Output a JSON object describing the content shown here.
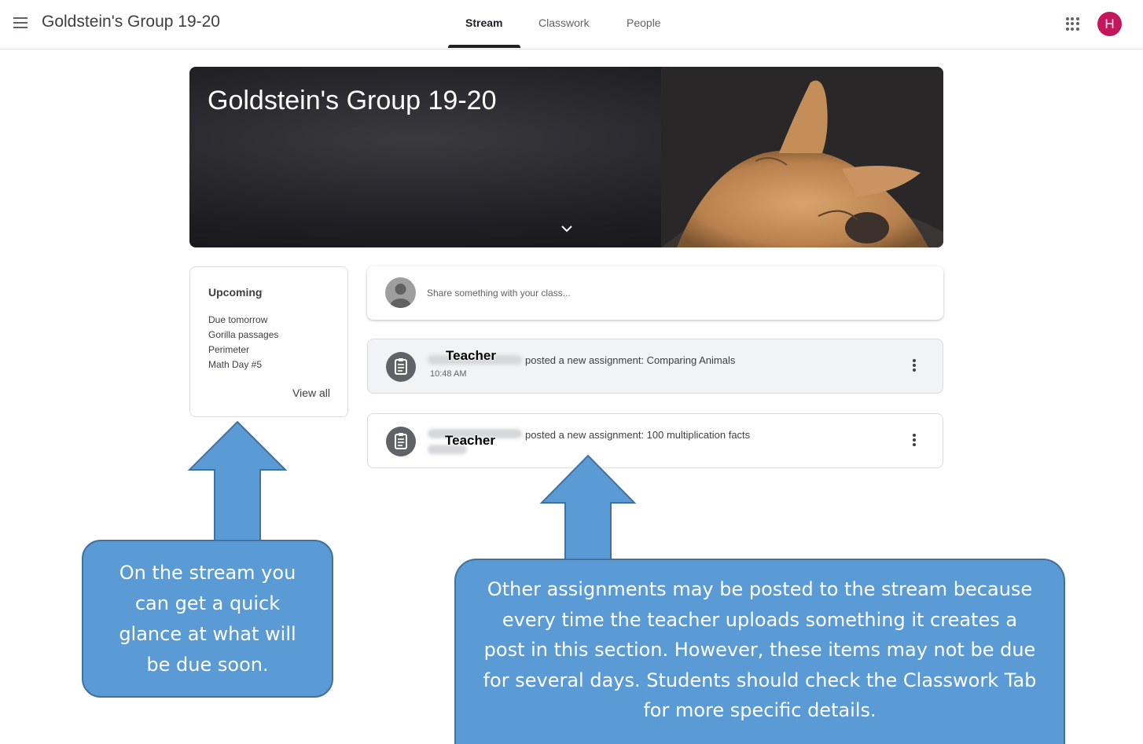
{
  "topbar": {
    "menu_icon": "hamburger-menu-icon",
    "class_title": "Goldstein's Group 19-20",
    "tabs": [
      {
        "label": "Stream",
        "active": true
      },
      {
        "label": "Classwork",
        "active": false
      },
      {
        "label": "People",
        "active": false
      }
    ],
    "apps_icon": "google-apps-grid-icon",
    "avatar_initial": "H",
    "avatar_color": "#c2185b"
  },
  "banner": {
    "title": "Goldstein's Group 19-20",
    "expand_icon": "chevron-down-icon"
  },
  "upcoming": {
    "heading": "Upcoming",
    "lines": [
      "Due tomorrow",
      "Gorilla passages",
      "Perimeter",
      "Math Day #5"
    ],
    "view_all": "View all"
  },
  "share": {
    "placeholder": "Share something with your class..."
  },
  "posts": [
    {
      "author": "Teacher",
      "text": "posted a new assignment: Comparing Animals",
      "time": "10:48 AM",
      "icon": "assignment-icon",
      "menu_icon": "more-vert-icon"
    },
    {
      "author": "Teacher",
      "text": "posted a new assignment: 100 multiplication facts",
      "icon": "assignment-icon",
      "menu_icon": "more-vert-icon"
    }
  ],
  "callouts": {
    "left": "On the stream you can get a quick glance at what will be due soon.",
    "right": "Other assignments may be posted to the stream because every time the teacher uploads something it creates a post in this section.  However, these items may not be due for several days. Students should check the Classwork Tab for more specific details.",
    "color": "#5b9bd5"
  }
}
